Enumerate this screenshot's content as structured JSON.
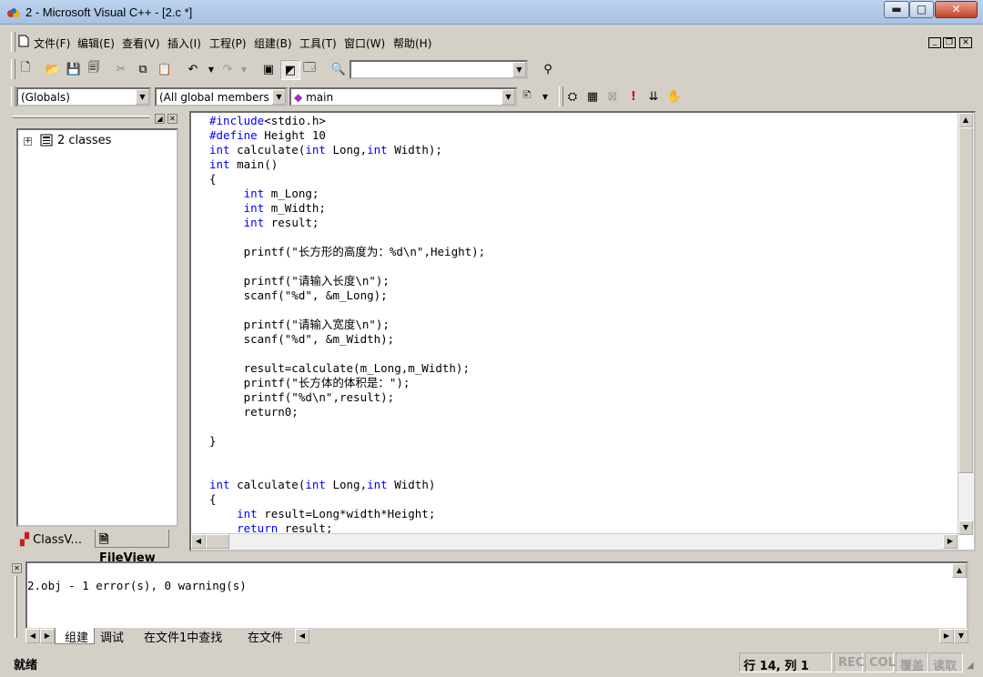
{
  "window": {
    "title": "2 - Microsoft Visual C++ - [2.c *]",
    "minimize": "▬",
    "maximize": "□",
    "close": "✕"
  },
  "menu": [
    "文件(F)",
    "编辑(E)",
    "查看(V)",
    "插入(I)",
    "工程(P)",
    "组建(B)",
    "工具(T)",
    "窗口(W)",
    "帮助(H)"
  ],
  "toolbar": {
    "find_value": ""
  },
  "wizardbar": {
    "scope": "(Globals)",
    "members": "(All global members",
    "function": "main"
  },
  "workspace": {
    "tree_root": "2 classes",
    "tabs": [
      "ClassV...",
      "FileView"
    ]
  },
  "editor": {
    "lines": [
      [
        {
          "t": "#include",
          "k": 1
        },
        {
          "t": "<stdio.h>"
        }
      ],
      [
        {
          "t": "#define",
          "k": 1
        },
        {
          "t": " Height 10"
        }
      ],
      [
        {
          "t": "int",
          "k": 1
        },
        {
          "t": " calculate("
        },
        {
          "t": "int",
          "k": 1
        },
        {
          "t": " Long,"
        },
        {
          "t": "int",
          "k": 1
        },
        {
          "t": " Width);"
        }
      ],
      [
        {
          "t": "int",
          "k": 1
        },
        {
          "t": " main()"
        }
      ],
      [
        {
          "t": "{"
        }
      ],
      [
        {
          "t": "     "
        },
        {
          "t": "int",
          "k": 1
        },
        {
          "t": " m_Long;"
        }
      ],
      [
        {
          "t": "     "
        },
        {
          "t": "int",
          "k": 1
        },
        {
          "t": " m_Width;"
        }
      ],
      [
        {
          "t": "     "
        },
        {
          "t": "int",
          "k": 1
        },
        {
          "t": " result;"
        }
      ],
      [
        {
          "t": ""
        }
      ],
      [
        {
          "t": "     printf(\"长方形的高度为：%d\\n\",Height);"
        }
      ],
      [
        {
          "t": ""
        }
      ],
      [
        {
          "t": "     printf(\"请输入长度\\n\");"
        }
      ],
      [
        {
          "t": "     scanf(\"%d\", &m_Long);"
        }
      ],
      [
        {
          "t": ""
        }
      ],
      [
        {
          "t": "     printf(\"请输入宽度\\n\");"
        }
      ],
      [
        {
          "t": "     scanf(\"%d\", &m_Width);"
        }
      ],
      [
        {
          "t": ""
        }
      ],
      [
        {
          "t": "     result=calculate(m_Long,m_Width);"
        }
      ],
      [
        {
          "t": "     printf(\"长方体的体积是：\");"
        }
      ],
      [
        {
          "t": "     printf(\"%d\\n\",result);"
        }
      ],
      [
        {
          "t": "     return0;"
        }
      ],
      [
        {
          "t": ""
        }
      ],
      [
        {
          "t": "}"
        }
      ],
      [
        {
          "t": ""
        }
      ],
      [
        {
          "t": ""
        }
      ],
      [
        {
          "t": "int",
          "k": 1
        },
        {
          "t": " calculate("
        },
        {
          "t": "int",
          "k": 1
        },
        {
          "t": " Long,"
        },
        {
          "t": "int",
          "k": 1
        },
        {
          "t": " Width)"
        }
      ],
      [
        {
          "t": "{"
        }
      ],
      [
        {
          "t": "    "
        },
        {
          "t": "int",
          "k": 1
        },
        {
          "t": " result=Long*width*Height;"
        }
      ],
      [
        {
          "t": "    "
        },
        {
          "t": "return",
          "k": 1
        },
        {
          "t": " result;"
        }
      ]
    ]
  },
  "output": {
    "text": "2.obj - 1 error(s), 0 warning(s)",
    "tabs": [
      "组建",
      "调试",
      "在文件1中查找",
      "在文件"
    ]
  },
  "status": {
    "ready": "就绪",
    "position": "行 14, 列 1",
    "rec": "REC",
    "col": "COL",
    "ovr": "覆盖",
    "read": "读取"
  },
  "colors": {
    "keyword": "#0000ff",
    "face": "#d4d0c8"
  }
}
